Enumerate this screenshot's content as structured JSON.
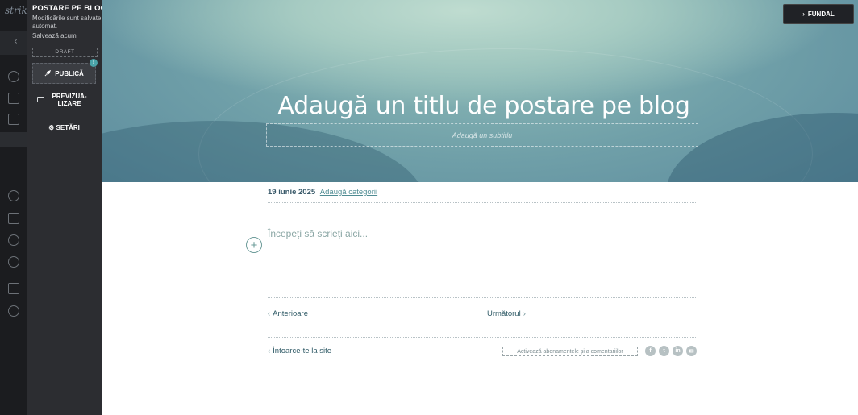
{
  "app": {
    "logo_text": "strik"
  },
  "panel": {
    "title": "POSTARE PE BLOG",
    "autosave_note": "Modificările sunt salvate automat.",
    "save_now": "Salvează acum",
    "status": "DRAFT",
    "publish_label": "PUBLICĂ",
    "publish_badge": "!",
    "preview_label": "PREVIZUA-\nLIZARE",
    "settings_label": "SETĂRI"
  },
  "hero": {
    "background_button": "FUNDAL",
    "post_title_placeholder": "Adaugă un titlu de postare pe blog",
    "subtitle_placeholder": "Adaugă un subtitlu"
  },
  "post": {
    "date": "19 iunie 2025",
    "add_categories": "Adaugă categorii",
    "body_placeholder": "Începeți să scrieți aici..."
  },
  "navigation": {
    "previous": "Anterioare",
    "next": "Următorul",
    "back_to_site": "Întoarce-te la site",
    "enable_subscriptions": "Activează abonamentele și a comentariilor"
  },
  "social_icons": [
    {
      "name": "facebook-icon",
      "glyph": "f"
    },
    {
      "name": "twitter-icon",
      "glyph": "t"
    },
    {
      "name": "linkedin-icon",
      "glyph": "in"
    },
    {
      "name": "email-icon",
      "glyph": "✉"
    }
  ],
  "colors": {
    "panel_bg": "#2c2d31",
    "accent_teal": "#4f8c93",
    "hero_top": "#bfdcd0",
    "hero_bottom": "#5d8c9e"
  }
}
